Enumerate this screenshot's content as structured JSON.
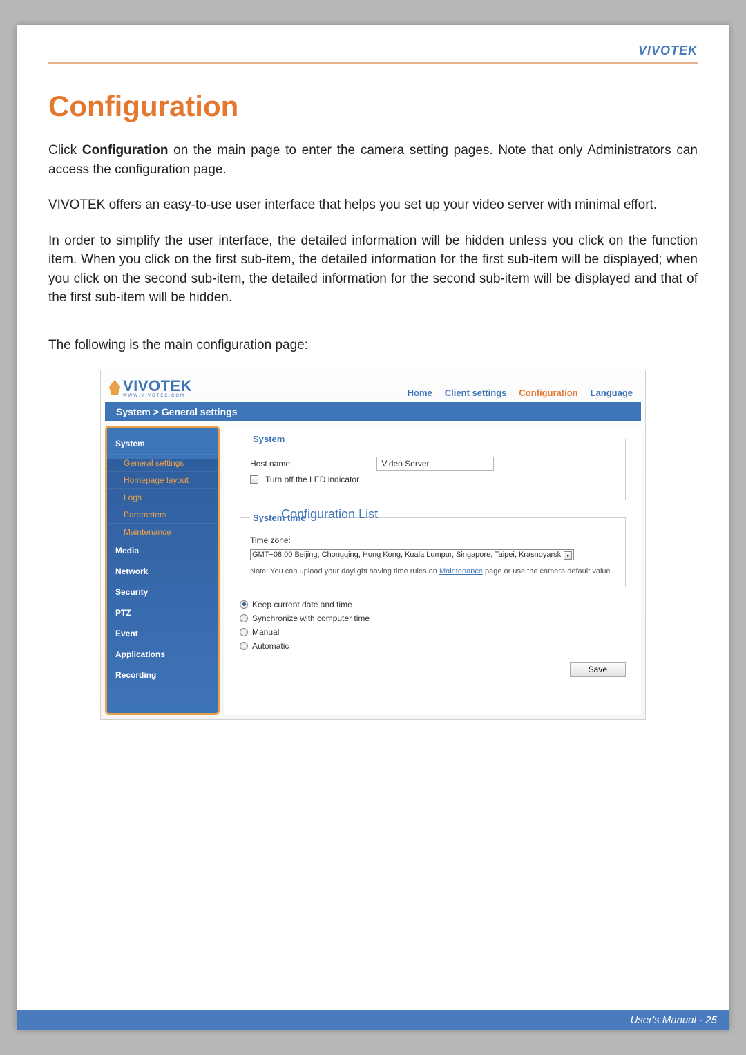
{
  "header": {
    "brand": "VIVOTEK"
  },
  "title": "Configuration",
  "paragraphs": {
    "p1_pre": "Click ",
    "p1_bold": "Configuration",
    "p1_post": " on the main page to enter the camera setting pages. Note that only Administrators can access the configuration page.",
    "p2": "VIVOTEK offers an easy-to-use user interface that helps you set up your video server with minimal effort.",
    "p3": "In order to simplify the user interface, the detailed information will be hidden unless you click on the function item. When you click on the first sub-item, the detailed information for the first sub-item will be displayed; when you click on the second sub-item, the detailed information for the second sub-item will be displayed and that of the first sub-item will be hidden."
  },
  "caption": "The following is the main configuration page:",
  "screenshot": {
    "logo_word": "VIVOTEK",
    "logo_sub": "WWW.VIVOTEK.COM",
    "nav": {
      "home": "Home",
      "client": "Client settings",
      "config": "Configuration",
      "lang": "Language"
    },
    "breadcrumb": "System  >  General settings",
    "sidebar": {
      "items": [
        {
          "label": "System",
          "kind": "head"
        },
        {
          "label": "General settings",
          "kind": "sub"
        },
        {
          "label": "Homepage layout",
          "kind": "sub"
        },
        {
          "label": "Logs",
          "kind": "sub"
        },
        {
          "label": "Parameters",
          "kind": "sub"
        },
        {
          "label": "Maintenance",
          "kind": "sub"
        },
        {
          "label": "Media",
          "kind": "head"
        },
        {
          "label": "Network",
          "kind": "head"
        },
        {
          "label": "Security",
          "kind": "head"
        },
        {
          "label": "PTZ",
          "kind": "head"
        },
        {
          "label": "Event",
          "kind": "head"
        },
        {
          "label": "Applications",
          "kind": "head"
        },
        {
          "label": "Recording",
          "kind": "head"
        }
      ]
    },
    "panel": {
      "system_legend": "System",
      "host_label": "Host name:",
      "host_value": "Video Server",
      "led_label": "Turn off the LED indicator",
      "time_legend": "System time",
      "config_list_label": "Configuration List",
      "tz_label": "Time zone:",
      "tz_value": "GMT+08:00 Beijing, Chongqing, Hong Kong, Kuala Lumpur, Singapore, Taipei, Krasnoyarsk",
      "note_pre": "Note: You can upload your daylight saving time rules on ",
      "note_link": "Maintenance",
      "note_post": " page or use the camera default value.",
      "radios": {
        "r1": "Keep current date and time",
        "r2": "Synchronize with computer time",
        "r3": "Manual",
        "r4": "Automatic"
      },
      "save": "Save"
    }
  },
  "footer": "User's Manual - 25"
}
